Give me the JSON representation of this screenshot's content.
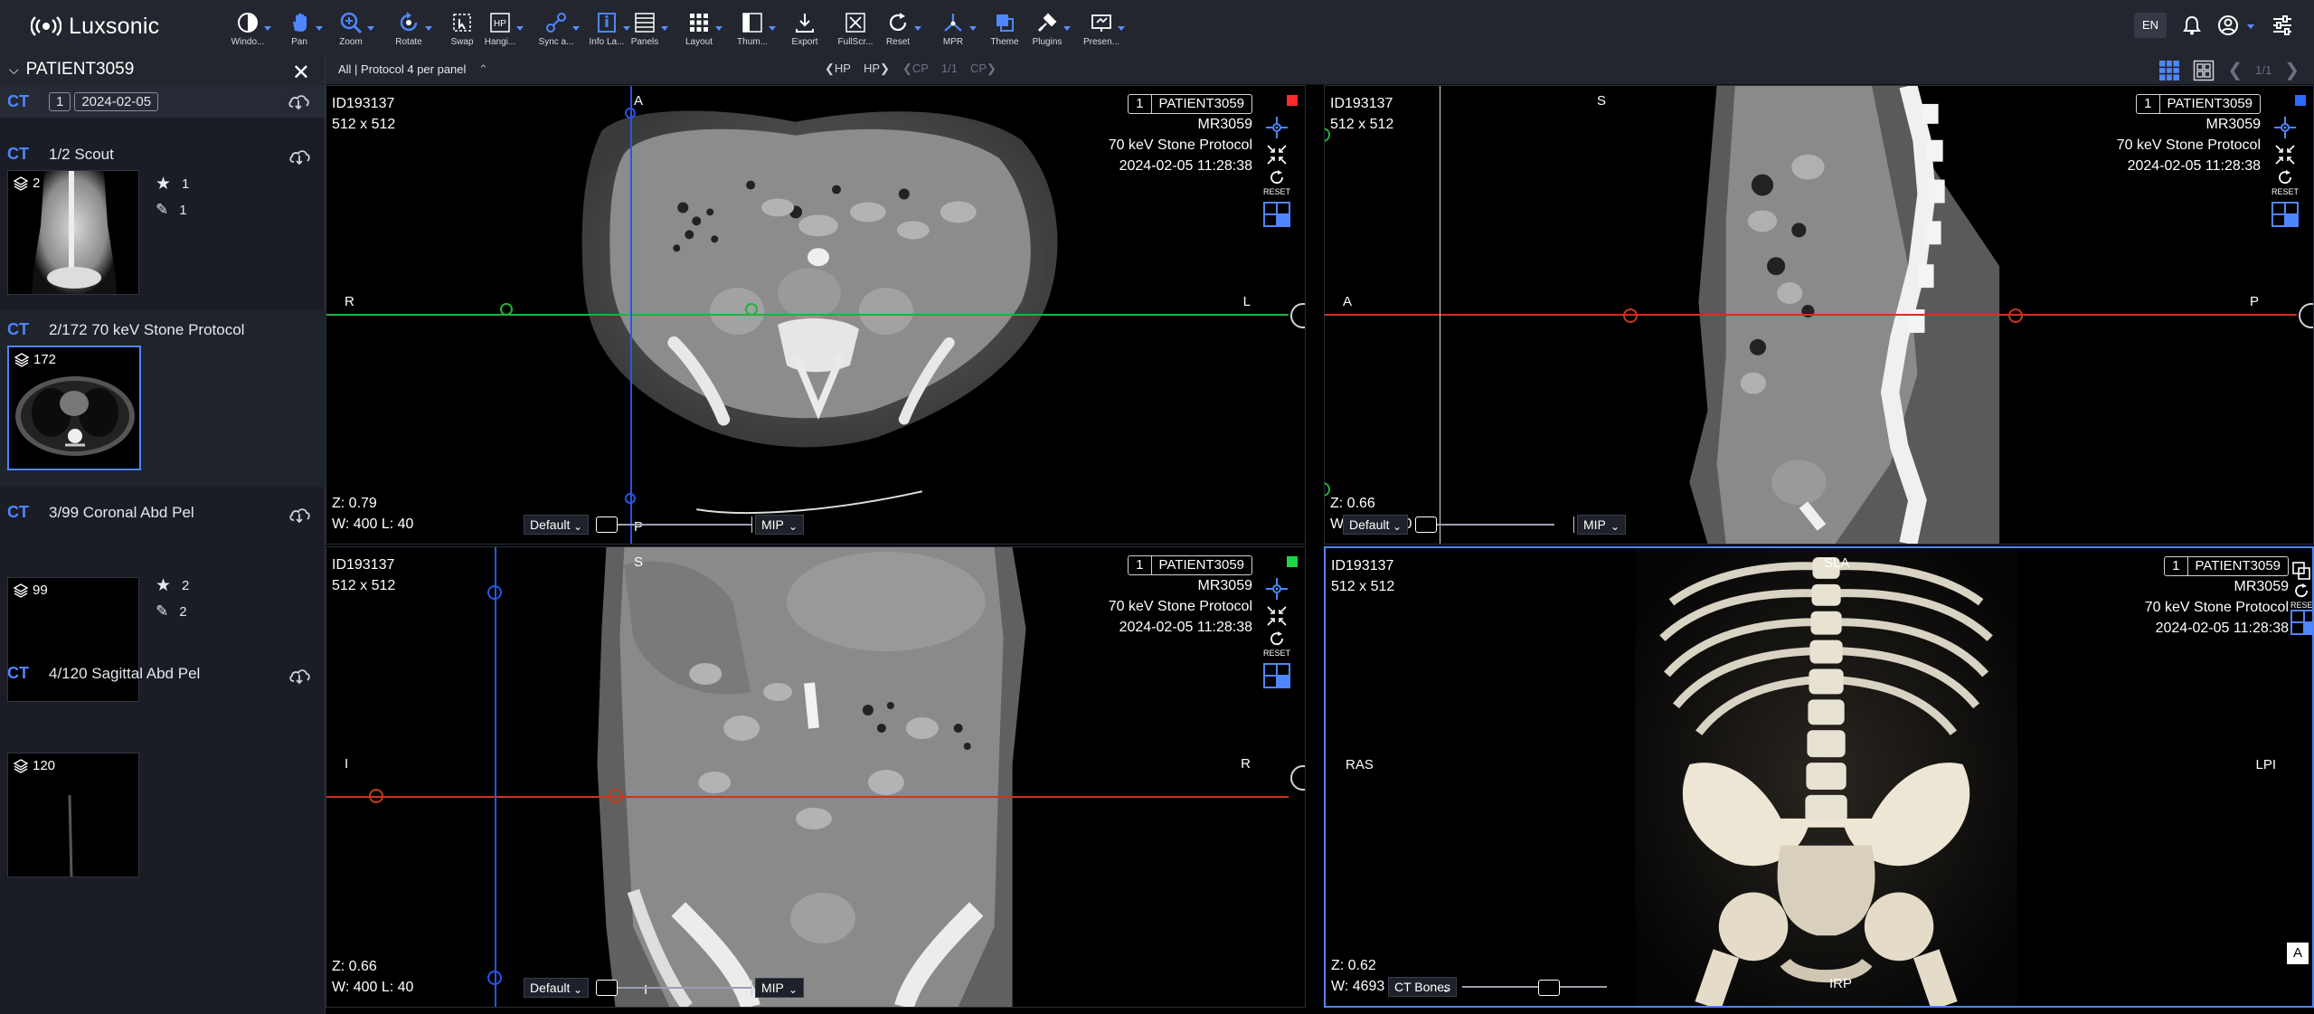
{
  "app": {
    "brand": "Luxsonic"
  },
  "toolbar": {
    "tools": [
      {
        "label": "Windo...",
        "icon": "window-level-icon"
      },
      {
        "label": "Pan",
        "icon": "pan-icon"
      },
      {
        "label": "Zoom",
        "icon": "zoom-icon"
      },
      {
        "label": "Rotate",
        "icon": "rotate-icon"
      },
      {
        "label": "Swap",
        "icon": "swap-icon"
      },
      {
        "label": "Hangi...",
        "icon": "hanging-protocol-icon"
      },
      {
        "label": "Sync a...",
        "icon": "sync-icon"
      },
      {
        "label": "Info La...",
        "icon": "info-layer-icon"
      },
      {
        "label": "Panels",
        "icon": "panels-icon"
      },
      {
        "label": "Layout",
        "icon": "layout-icon"
      },
      {
        "label": "Thum...",
        "icon": "thumbnails-icon"
      },
      {
        "label": "Export",
        "icon": "export-icon"
      },
      {
        "label": "FullScr...",
        "icon": "fullscreen-icon"
      },
      {
        "label": "Reset",
        "icon": "reset-icon"
      },
      {
        "label": "MPR",
        "icon": "mpr-icon"
      },
      {
        "label": "Theme",
        "icon": "theme-icon"
      },
      {
        "label": "Plugins",
        "icon": "plugins-icon"
      },
      {
        "label": "Presen...",
        "icon": "presentation-icon"
      }
    ],
    "language": "EN"
  },
  "subbar": {
    "protocol": "All | Protocol 4 per panel",
    "hp_prev": "HP",
    "hp_next": "HP",
    "cp_prev": "CP",
    "page": "1/1",
    "cp_next": "CP",
    "page_right": "1/1"
  },
  "patient_panel": {
    "patient": "PATIENT3059",
    "study": {
      "modality": "CT",
      "number": "1",
      "date": "2024-02-05"
    },
    "series": [
      {
        "modality": "CT",
        "title": "1/2 Scout",
        "count": "2",
        "stars": "1",
        "annotations": "1"
      },
      {
        "modality": "CT",
        "title": "2/172 70 keV Stone Protocol",
        "count": "172"
      },
      {
        "modality": "CT",
        "title": "3/99 Coronal Abd Pel",
        "count": "99",
        "stars": "2",
        "annotations": "2"
      },
      {
        "modality": "CT",
        "title": "4/120 Sagittal Abd Pel",
        "count": "120"
      }
    ]
  },
  "viewports": [
    {
      "id": "ID193137",
      "matrix": "512 x 512",
      "num": "1",
      "patient": "PATIENT3059",
      "mr": "MR3059",
      "protocol": "70 keV Stone Protocol",
      "datetime": "2024-02-05 11:28:38",
      "zoom": "Z: 0.79",
      "wl": "W: 400 L: 40",
      "orient": {
        "top": "A",
        "bottom": "P",
        "left": "R",
        "right": "L"
      },
      "preset": "Default",
      "render": "MIP",
      "marker_color": "#ff2a2a",
      "reset": "RESET"
    },
    {
      "id": "ID193137",
      "matrix": "512 x 512",
      "num": "1",
      "patient": "PATIENT3059",
      "mr": "MR3059",
      "protocol": "70 keV Stone Protocol",
      "datetime": "2024-02-05 11:28:38",
      "zoom": "Z: 0.66",
      "wl": "W: 400 L: 40",
      "orient": {
        "top": "S",
        "left": "A",
        "right": "P"
      },
      "preset": "Default",
      "render": "MIP",
      "marker_color": "#2a6bff",
      "reset": "RESET"
    },
    {
      "id": "ID193137",
      "matrix": "512 x 512",
      "num": "1",
      "patient": "PATIENT3059",
      "mr": "MR3059",
      "protocol": "70 keV Stone Protocol",
      "datetime": "2024-02-05 11:28:38",
      "zoom": "Z: 0.66",
      "wl": "W: 400 L: 40",
      "orient": {
        "top": "S",
        "bottom": "I",
        "left": "I",
        "right": "R"
      },
      "preset": "Default",
      "render": "MIP",
      "marker_color": "#21d443",
      "reset": "RESET"
    },
    {
      "id": "ID193137",
      "matrix": "512 x 512",
      "num": "1",
      "patient": "PATIENT3059",
      "mr": "MR3059",
      "protocol": "70 keV Stone Protocol",
      "datetime": "2024-02-05 11:28:38",
      "zoom": "Z: 0.62",
      "wl": "W: 4693 L: -678",
      "orient": {
        "top": "SLA",
        "bottom": "IRP",
        "left": "RAS",
        "right": "LPI"
      },
      "preset": "CT Bones",
      "corner_label": "A",
      "reset": "RESET"
    }
  ]
}
